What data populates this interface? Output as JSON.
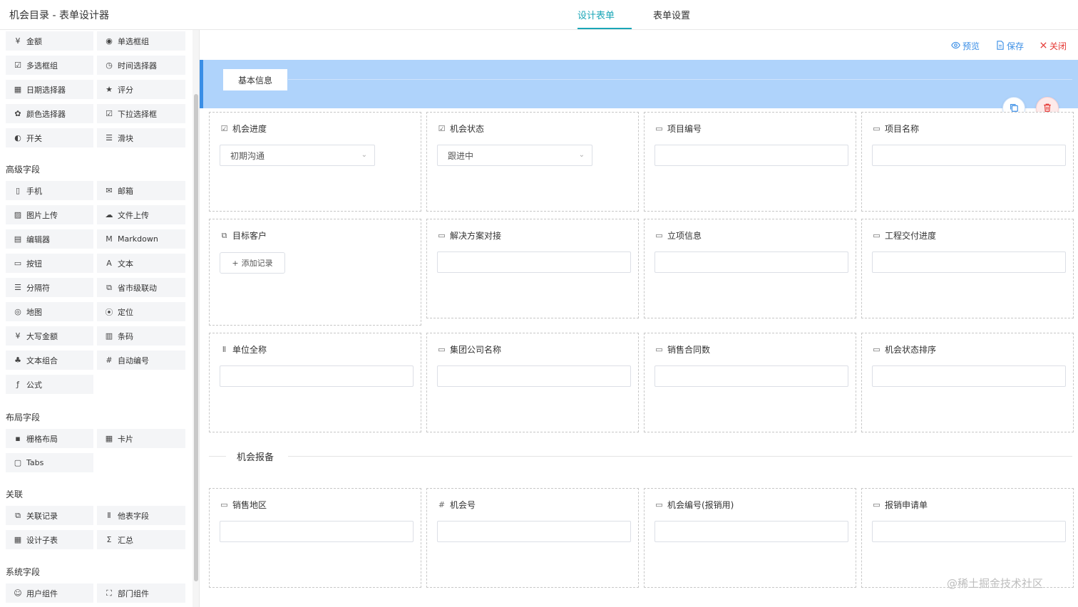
{
  "header": {
    "title": "机会目录 - 表单设计器",
    "tabs": [
      {
        "label": "设计表单",
        "active": true
      },
      {
        "label": "表单设置",
        "active": false
      }
    ]
  },
  "palette": {
    "basic_items": [
      {
        "label": "金额",
        "icon": "money-icon"
      },
      {
        "label": "单选框组",
        "icon": "radio-icon"
      },
      {
        "label": "多选框组",
        "icon": "checkbox-icon"
      },
      {
        "label": "时间选择器",
        "icon": "clock-icon"
      },
      {
        "label": "日期选择器",
        "icon": "calendar-icon"
      },
      {
        "label": "评分",
        "icon": "star-icon"
      },
      {
        "label": "颜色选择器",
        "icon": "palette-icon"
      },
      {
        "label": "下拉选择框",
        "icon": "dropdown-icon"
      },
      {
        "label": "开关",
        "icon": "toggle-icon"
      },
      {
        "label": "滑块",
        "icon": "slider-icon"
      }
    ],
    "sections": [
      {
        "title": "高级字段",
        "items": [
          {
            "label": "手机",
            "icon": "phone-icon"
          },
          {
            "label": "邮箱",
            "icon": "mail-icon"
          },
          {
            "label": "图片上传",
            "icon": "image-upload-icon"
          },
          {
            "label": "文件上传",
            "icon": "cloud-upload-icon"
          },
          {
            "label": "编辑器",
            "icon": "editor-icon"
          },
          {
            "label": "Markdown",
            "icon": "markdown-icon"
          },
          {
            "label": "按钮",
            "icon": "button-icon"
          },
          {
            "label": "文本",
            "icon": "text-icon"
          },
          {
            "label": "分隔符",
            "icon": "divider-icon"
          },
          {
            "label": "省市级联动",
            "icon": "cascade-icon"
          },
          {
            "label": "地图",
            "icon": "map-icon"
          },
          {
            "label": "定位",
            "icon": "location-icon"
          },
          {
            "label": "大写金额",
            "icon": "money-upper-icon"
          },
          {
            "label": "条码",
            "icon": "barcode-icon"
          },
          {
            "label": "文本组合",
            "icon": "combine-icon"
          },
          {
            "label": "自动编号",
            "icon": "hash-icon"
          },
          {
            "label": "公式",
            "icon": "formula-icon"
          }
        ]
      },
      {
        "title": "布局字段",
        "items": [
          {
            "label": "栅格布局",
            "icon": "grid-icon"
          },
          {
            "label": "卡片",
            "icon": "card-icon"
          },
          {
            "label": "Tabs",
            "icon": "tabs-icon"
          }
        ]
      },
      {
        "title": "关联",
        "items": [
          {
            "label": "关联记录",
            "icon": "link-record-icon"
          },
          {
            "label": "他表字段",
            "icon": "other-table-icon"
          },
          {
            "label": "设计子表",
            "icon": "subtable-icon"
          },
          {
            "label": "汇总",
            "icon": "sum-icon"
          }
        ]
      },
      {
        "title": "系统字段",
        "items": [
          {
            "label": "用户组件",
            "icon": "user-icon"
          },
          {
            "label": "部门组件",
            "icon": "org-icon"
          }
        ]
      }
    ]
  },
  "actions": {
    "preview": "预览",
    "save": "保存",
    "close": "关闭"
  },
  "section1": {
    "title": "基本信息",
    "fields": [
      {
        "label": "机会进度",
        "type": "select",
        "value": "初期沟通",
        "icon": "checkbox-icon"
      },
      {
        "label": "机会状态",
        "type": "select",
        "value": "跟进中",
        "icon": "checkbox-icon"
      },
      {
        "label": "项目编号",
        "type": "input",
        "icon": "input-icon"
      },
      {
        "label": "项目名称",
        "type": "input",
        "icon": "input-icon"
      },
      {
        "label": "目标客户",
        "type": "record",
        "button": "添加记录",
        "icon": "link-record-icon"
      },
      {
        "label": "解决方案对接",
        "type": "input",
        "icon": "input-icon"
      },
      {
        "label": "立项信息",
        "type": "input",
        "icon": "input-icon"
      },
      {
        "label": "工程交付进度",
        "type": "input",
        "icon": "input-icon"
      },
      {
        "label": "单位全称",
        "type": "input",
        "icon": "other-table-icon"
      },
      {
        "label": "集团公司名称",
        "type": "input",
        "icon": "input-icon"
      },
      {
        "label": "销售合同数",
        "type": "input",
        "icon": "input-icon"
      },
      {
        "label": "机会状态排序",
        "type": "input",
        "icon": "input-icon"
      }
    ]
  },
  "section2": {
    "title": "机会报备",
    "fields": [
      {
        "label": "销售地区",
        "type": "input",
        "icon": "input-icon"
      },
      {
        "label": "机会号",
        "type": "input",
        "icon": "hash-icon"
      },
      {
        "label": "机会编号(报销用)",
        "type": "input",
        "icon": "input-icon"
      },
      {
        "label": "报销申请单",
        "type": "input",
        "icon": "input-icon"
      }
    ]
  },
  "watermark": "@稀土掘金技术社区"
}
